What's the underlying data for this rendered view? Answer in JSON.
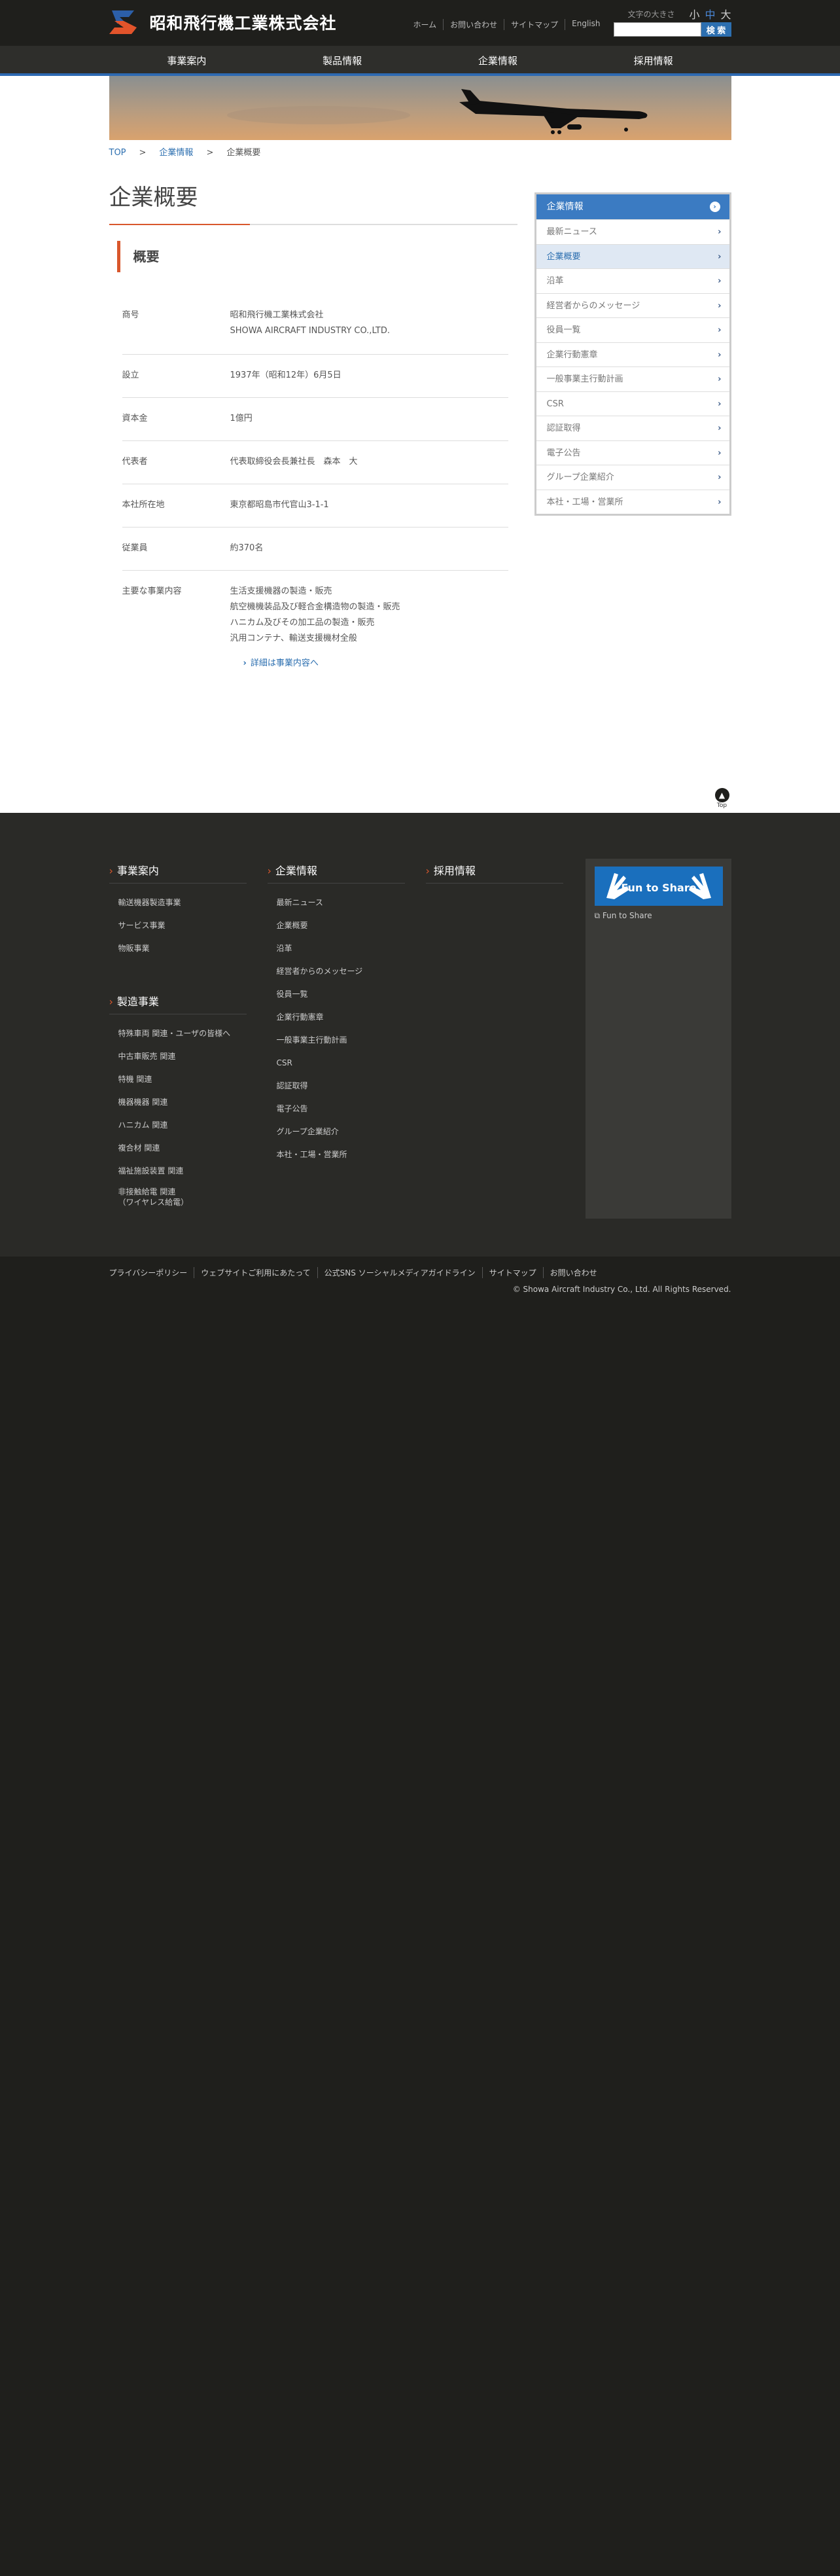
{
  "header": {
    "company_name": "昭和飛行機工業株式会社",
    "utility_links": [
      "ホーム",
      "お問い合わせ",
      "サイトマップ",
      "English"
    ],
    "font_size_label": "文字の大きさ",
    "font_sizes": [
      "小",
      "中",
      "大"
    ],
    "search_placeholder": "",
    "search_button": "検 索"
  },
  "gnav": [
    "事業案内",
    "製品情報",
    "企業情報",
    "採用情報"
  ],
  "breadcrumb": [
    "TOP",
    "企業情報",
    "企業概要"
  ],
  "main": {
    "title": "企業概要",
    "section_title": "概要",
    "rows": [
      {
        "label": "商号",
        "lines": [
          "昭和飛行機工業株式会社",
          "SHOWA AIRCRAFT INDUSTRY CO.,LTD."
        ]
      },
      {
        "label": "設立",
        "lines": [
          "1937年（昭和12年）6月5日"
        ]
      },
      {
        "label": "資本金",
        "lines": [
          "1億円"
        ]
      },
      {
        "label": "代表者",
        "lines": [
          "代表取締役会長兼社長　森本　大"
        ]
      },
      {
        "label": "本社所在地",
        "lines": [
          "東京都昭島市代官山3-1-1"
        ]
      },
      {
        "label": "従業員",
        "lines": [
          "約370名"
        ]
      },
      {
        "label": "主要な事業内容",
        "lines": [
          "生活支援機器の製造・販売",
          "航空機機装品及び軽合金構造物の製造・販売",
          "ハニカム及びその加工品の製造・販売",
          "汎用コンテナ、輸送支援機材全般"
        ]
      }
    ],
    "detail_link": "詳細は事業内容へ"
  },
  "sidebar": {
    "head": "企業情報",
    "items": [
      "最新ニュース",
      "企業概要",
      "沿革",
      "経営者からのメッセージ",
      "役員一覧",
      "企業行動憲章",
      "一般事業主行動計画",
      "CSR",
      "認証取得",
      "電子公告",
      "グループ企業紹介",
      "本社・工場・営業所"
    ],
    "active_index": 1
  },
  "totop": "Top",
  "footer": {
    "col1_title": "事業案内",
    "col1_items": [
      "輸送機器製造事業",
      "サービス事業",
      "物販事業"
    ],
    "col1b_title": "製造事業",
    "col1b_items": [
      "特殊車両 関連・ユーザの皆様へ",
      "中古車販売 関連",
      "特機 関連",
      "機器機器 関連",
      "ハニカム 関連",
      "複合材 関連",
      "福祉施設装置 関連"
    ],
    "col1b_last_line1": "非接触給電 関連",
    "col1b_last_line2": "（ワイヤレス給電）",
    "col2_title": "企業情報",
    "col2_items": [
      "最新ニュース",
      "企業概要",
      "沿革",
      "経営者からのメッセージ",
      "役員一覧",
      "企業行動憲章",
      "一般事業主行動計画",
      "CSR",
      "認証取得",
      "電子公告",
      "グループ企業紹介",
      "本社・工場・営業所"
    ],
    "col3_title": "採用情報",
    "banner_text": "Fun to Share",
    "banner_link": "Fun to Share"
  },
  "bottom": {
    "links": [
      "プライバシーポリシー",
      "ウェブサイトご利用にあたって",
      "公式SNS ソーシャルメディアガイドライン",
      "サイトマップ",
      "お問い合わせ"
    ],
    "copyright": "© Showa Aircraft Industry Co., Ltd. All Rights Reserved."
  },
  "colors": {
    "accent_blue": "#2c6fb0",
    "accent_orange": "#d9572c",
    "dark_bg": "#1f1f1c"
  }
}
